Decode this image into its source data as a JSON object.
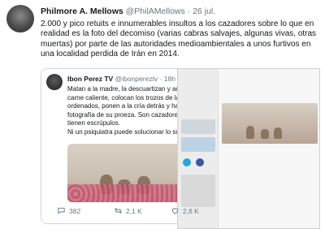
{
  "tweet": {
    "author_name": "Philmore A. Mellows",
    "author_handle": "@PhilAMellows",
    "separator": "·",
    "date": "26 jul.",
    "text": "2.000 y pico retuits e innumerables insultos a los cazadores sobre lo que en realidad es la foto del decomiso (varias cabras salvajes, algunas vivas, otras muertas) por parte de las autoridades medioambientales a unos furtivos en una localidad perdida de Irán en 2014."
  },
  "quoted_tweet": {
    "author_name": "Ibon Perez TV",
    "author_handle": "@ibonpereztv",
    "separator": "·",
    "time": "18h",
    "text_lines": [
      "Matan a la madre, la descuartizan y aún c",
      "carne caliente, colocan los trozos de la c",
      "ordenados, ponen a la cría detrás  y hace",
      "fotografía de su proeza. Son cazadores,",
      "tienen escrúpulos.",
      "Ni un psiquiatra puede solucionar lo suyo"
    ]
  },
  "actions": {
    "replies": "382",
    "retweets": "2,1 K",
    "likes": "2,6 K"
  },
  "colors": {
    "secondary_text": "#657786",
    "border": "#ccd6dd"
  }
}
